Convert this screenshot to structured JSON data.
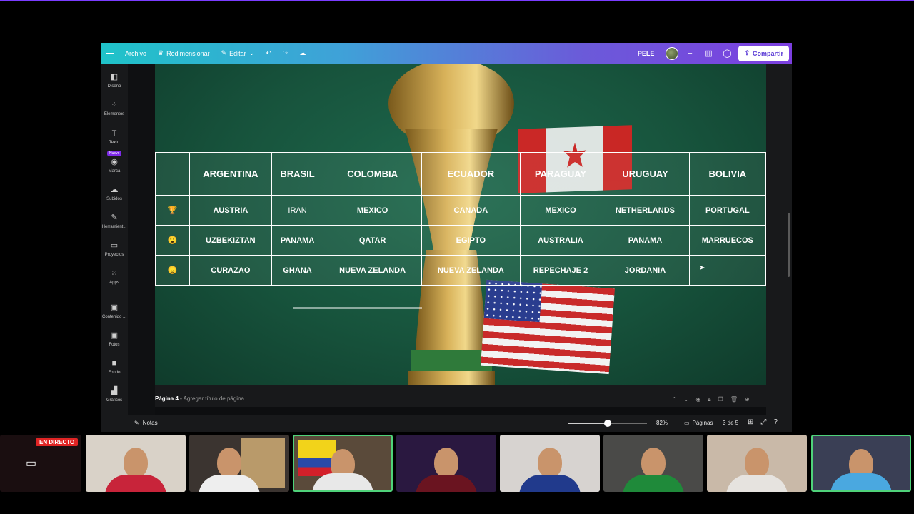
{
  "topbar": {
    "archivo": "Archivo",
    "redimensionar": "Redimensionar",
    "editar": "Editar",
    "user": "PELE",
    "share": "Compartir"
  },
  "sidebar": {
    "items": [
      "Diseño",
      "Elementos",
      "Texto",
      "Marca",
      "Subidos",
      "Herramient...",
      "Proyectos",
      "Apps",
      "Contenido ...",
      "Fotos",
      "Fondo",
      "Gráficos"
    ],
    "new_badge": "Nuevo"
  },
  "table": {
    "headers": [
      "ARGENTINA",
      "BRASIL",
      "COLOMBIA",
      "ECUADOR",
      "PARAGUAY",
      "URUGUAY",
      "BOLIVIA"
    ],
    "rows": [
      {
        "emoji": "🏆",
        "cells": [
          "AUSTRIA",
          "IRAN",
          "MEXICO",
          "CANADA",
          "MEXICO",
          "NETHERLANDS",
          "PORTUGAL"
        ]
      },
      {
        "emoji": "😮",
        "cells": [
          "UZBEKIZTAN",
          "PANAMA",
          "QATAR",
          "EGIPTO",
          "AUSTRALIA",
          "PANAMA",
          "MARRUECOS"
        ]
      },
      {
        "emoji": "😞",
        "cells": [
          "CURAZAO",
          "GHANA",
          "NUEVA ZELANDA",
          "NUEVA ZELANDA",
          "REPECHAJE 2",
          "JORDANIA",
          ""
        ]
      }
    ]
  },
  "page": {
    "label": "Página 4",
    "sep": " - ",
    "placeholder": "Agregar título de página"
  },
  "bottombar": {
    "notes": "Notas",
    "zoom": "82%",
    "zoom_fraction": 0.5,
    "pages": "Páginas",
    "page_count": "3 de 5"
  },
  "stream": {
    "live": "EN DIRECTO"
  },
  "colors": {
    "canva_gradient_start": "#1fc3c9",
    "canva_gradient_end": "#7c3fe0",
    "live_red": "#e02424",
    "active_cam": "#4fd27a"
  }
}
